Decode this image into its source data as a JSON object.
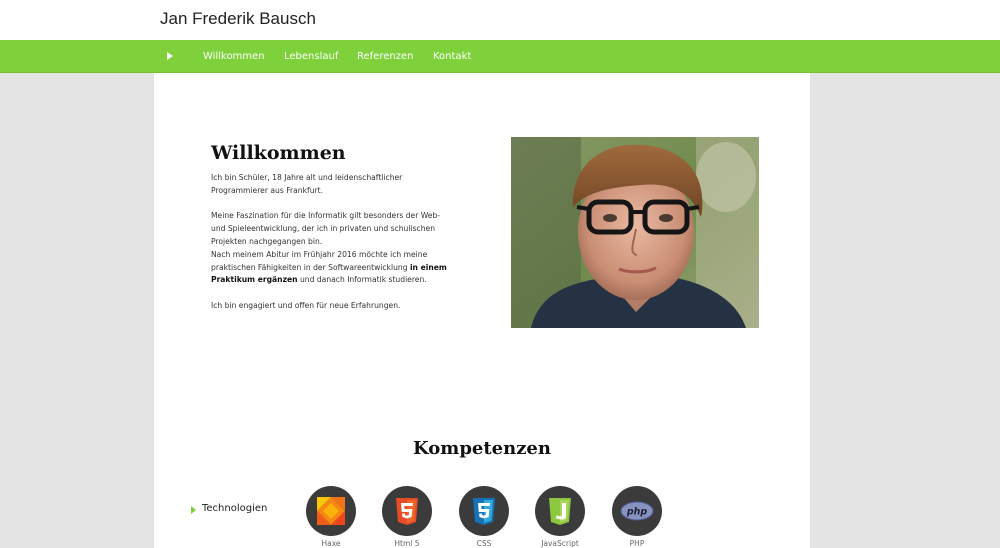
{
  "site": {
    "title": "Jan Frederik Bausch"
  },
  "nav": {
    "items": [
      {
        "label": "Willkommen"
      },
      {
        "label": "Lebenslauf"
      },
      {
        "label": "Referenzen"
      },
      {
        "label": "Kontakt"
      }
    ]
  },
  "welcome": {
    "heading": "Willkommen",
    "p1_l1": "Ich bin Schüler, 18 Jahre alt und leidenschaftlicher",
    "p1_l2": "Programmierer aus Frankfurt.",
    "p2_l1": "Meine Faszination für die Informatik gilt besonders der Web-",
    "p2_l2": "und Spieleentwicklung, der ich in privaten und schulischen",
    "p2_l3": "Projekten nachgegangen bin.",
    "p3_l1": "Nach meinem Abitur im Frühjahr 2016 möchte ich meine",
    "p3_l2a": "praktischen Fähigkeiten in der Softwareentwicklung ",
    "p3_l2b": "in einem",
    "p3_l3a": "Praktikum ergänzen",
    "p3_l3b": " und danach Informatik studieren.",
    "p4_l1": "Ich bin engagiert und offen für neue Erfahrungen."
  },
  "skills": {
    "heading": "Kompetenzen",
    "category": "Technologien",
    "items": [
      {
        "name": "Haxe",
        "icon": "haxe-icon"
      },
      {
        "name": "Html 5",
        "icon": "html5-icon"
      },
      {
        "name": "CSS",
        "icon": "css3-icon"
      },
      {
        "name": "JavaScript",
        "icon": "javascript-icon"
      },
      {
        "name": "PHP",
        "icon": "php-icon"
      }
    ]
  },
  "colors": {
    "accent": "#7fd13b",
    "background": "#e4e4e4",
    "skill_circle": "#3b3b3b",
    "haxe": "#f68712",
    "html5": "#e44d26",
    "css3": "#1572b6",
    "javascript": "#8dc63f",
    "php": "#8892bf"
  }
}
